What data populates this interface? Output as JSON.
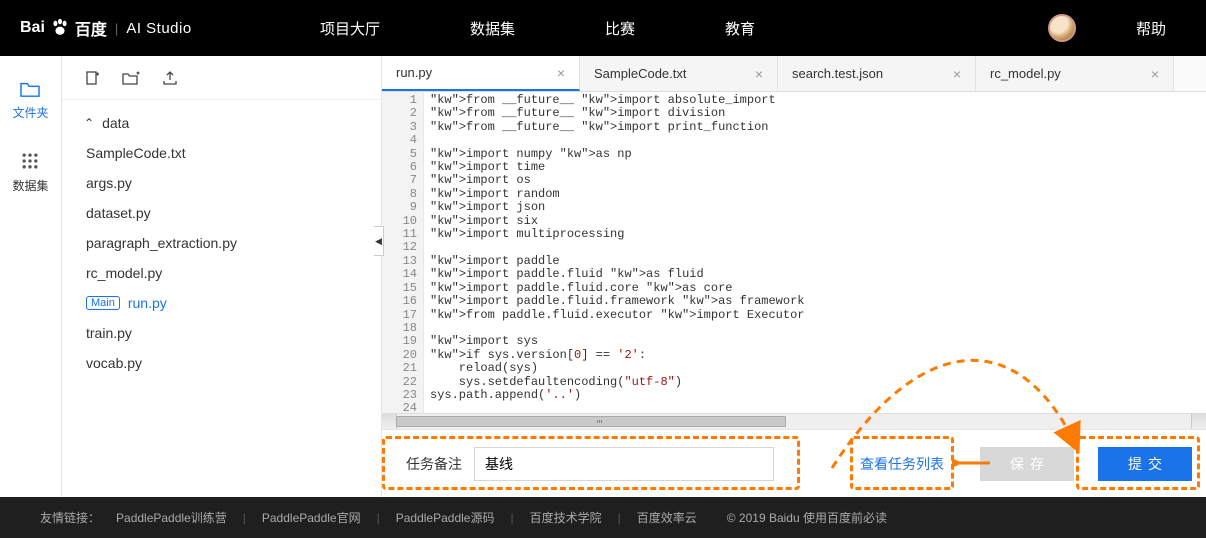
{
  "header": {
    "logo_text": "百度",
    "product": "AI Studio",
    "nav": [
      "项目大厅",
      "数据集",
      "比赛",
      "教育"
    ],
    "help": "帮助"
  },
  "rail": {
    "files": "文件夹",
    "datasets": "数据集"
  },
  "tree": {
    "folder": "data",
    "files": [
      "SampleCode.txt",
      "args.py",
      "dataset.py",
      "paragraph_extraction.py",
      "rc_model.py"
    ],
    "main_badge": "Main",
    "main_file": "run.py",
    "more_files": [
      "train.py",
      "vocab.py"
    ]
  },
  "tabs": [
    {
      "label": "run.py",
      "active": true
    },
    {
      "label": "SampleCode.txt",
      "active": false
    },
    {
      "label": "search.test.json",
      "active": false
    },
    {
      "label": "rc_model.py",
      "active": false
    }
  ],
  "code_lines": [
    "from __future__ import absolute_import",
    "from __future__ import division",
    "from __future__ import print_function",
    "",
    "import numpy as np",
    "import time",
    "import os",
    "import random",
    "import json",
    "import six",
    "import multiprocessing",
    "",
    "import paddle",
    "import paddle.fluid as fluid",
    "import paddle.fluid.core as core",
    "import paddle.fluid.framework as framework",
    "from paddle.fluid.executor import Executor",
    "",
    "import sys",
    "if sys.version[0] == '2':",
    "    reload(sys)",
    "    sys.setdefaultencoding(\"utf-8\")",
    "sys.path.append('..')",
    ""
  ],
  "actions": {
    "task_label": "任务备注",
    "task_value": "基线",
    "view_tasks": "查看任务列表",
    "save": "保存",
    "submit": "提交"
  },
  "footer": {
    "label": "友情链接：",
    "links": [
      "PaddlePaddle训练营",
      "PaddlePaddle官网",
      "PaddlePaddle源码",
      "百度技术学院",
      "百度效率云"
    ],
    "copyright": "© 2019 Baidu 使用百度前必读"
  }
}
